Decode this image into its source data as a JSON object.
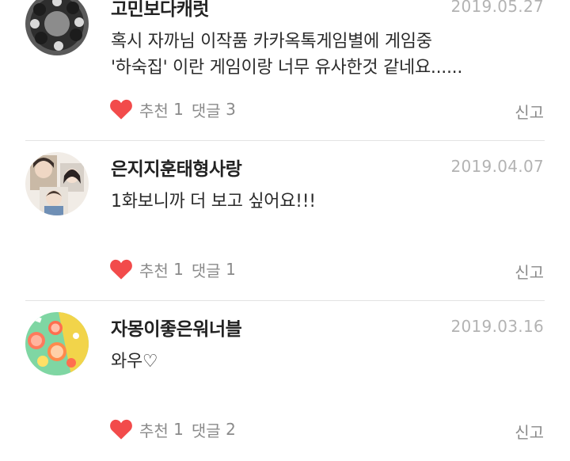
{
  "comments": [
    {
      "nickname": "고민보다캐럿",
      "date": "2019.05.27",
      "lines": [
        "혹시 자까님 이작품 카카옥톡게임별에 게임중",
        "'하숙집' 이란 게임이랑 너무 유사한것 같네요......"
      ],
      "like_label": "추천",
      "like_count": "1",
      "reply_label": "댓글",
      "reply_count": "3",
      "report_label": "신고",
      "avatar_icon": "group-photo-avatar-icon"
    },
    {
      "nickname": "은지지훈태형사랑",
      "date": "2019.04.07",
      "lines": [
        "1화보니까 더  보고 싶어요!!!"
      ],
      "like_label": "추천",
      "like_count": "1",
      "reply_label": "댓글",
      "reply_count": "1",
      "report_label": "신고",
      "avatar_icon": "collage-photo-avatar-icon"
    },
    {
      "nickname": "자몽이좋은워너블",
      "date": "2019.03.16",
      "lines": [
        "와우♡"
      ],
      "like_label": "추천",
      "like_count": "1",
      "reply_label": "댓글",
      "reply_count": "2",
      "report_label": "신고",
      "avatar_icon": "grapefruit-photo-avatar-icon"
    }
  ],
  "colors": {
    "heart": "#f24b4b",
    "date": "#b3b3b3",
    "meta": "#8a8a8a",
    "divider": "#e3e3e3"
  }
}
